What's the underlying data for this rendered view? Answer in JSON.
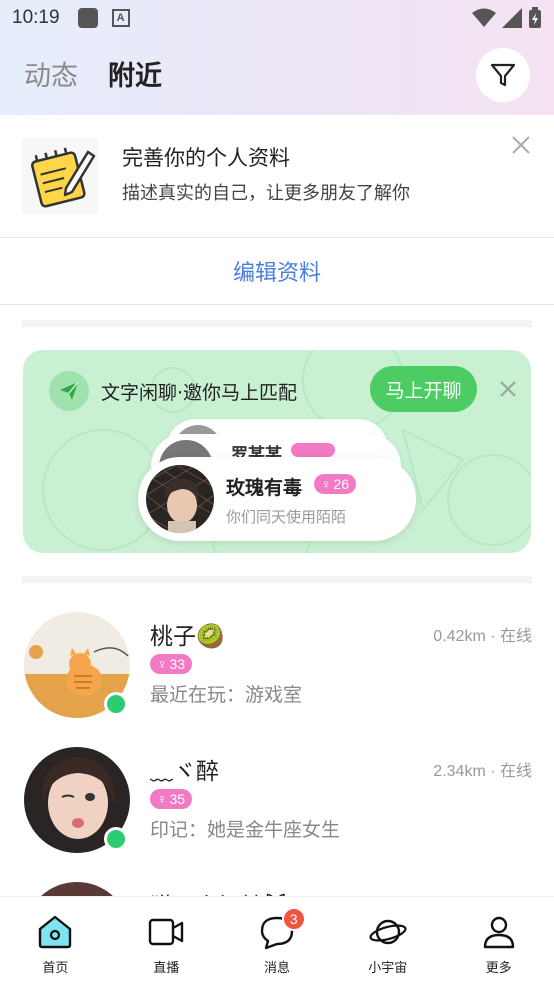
{
  "status_bar": {
    "time": "10:19"
  },
  "header": {
    "tabs": [
      {
        "label": "动态",
        "active": false
      },
      {
        "label": "附近",
        "active": true
      }
    ]
  },
  "profile_prompt": {
    "title": "完善你的个人资料",
    "subtitle": "描述真实的自己，让更多朋友了解你",
    "edit_label": "编辑资料"
  },
  "match_card": {
    "text": "文字闲聊·邀你马上匹配",
    "button_label": "马上开聊",
    "back_card_partial_name": "罗某某",
    "front_card": {
      "name": "玫瑰有毒",
      "age": "26",
      "subtitle": "你们同天使用陌陌"
    }
  },
  "users": [
    {
      "name": "桃子🥝",
      "age": "33",
      "meta": "0.42km · 在线",
      "desc": "最近在玩：游戏室",
      "online": true
    },
    {
      "name": "﹏ヾ醉",
      "age": "35",
      "meta": "2.34km · 在线",
      "desc": "印记：她是金牛座女生",
      "online": true
    },
    {
      "name": "猫...小坏精🐱",
      "age": "",
      "meta": "",
      "desc": "",
      "online": true
    }
  ],
  "bottom_nav": [
    {
      "label": "首页",
      "icon": "home-icon",
      "active": true
    },
    {
      "label": "直播",
      "icon": "video-icon",
      "active": false
    },
    {
      "label": "消息",
      "icon": "chat-icon",
      "active": false,
      "badge": "3"
    },
    {
      "label": "小宇宙",
      "icon": "planet-icon",
      "active": false
    },
    {
      "label": "更多",
      "icon": "person-icon",
      "active": false
    }
  ],
  "colors": {
    "accent_blue": "#4a7de0",
    "match_green": "#4ccc62",
    "online_green": "#2ecc71",
    "badge_pink": "#f27ac4",
    "badge_red": "#f05443"
  }
}
